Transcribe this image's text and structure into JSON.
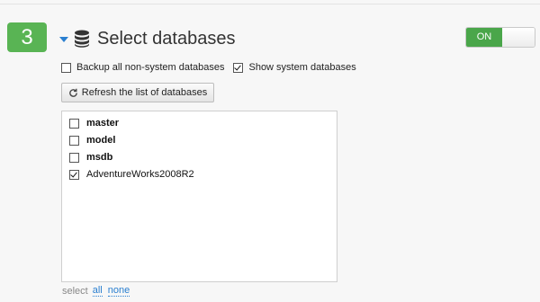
{
  "step": {
    "number": "3"
  },
  "header": {
    "title": "Select databases",
    "icon": "database-icon"
  },
  "toggle": {
    "label": "ON",
    "state": "on"
  },
  "options": {
    "backup_all_nonsystem": {
      "label": "Backup all non-system databases",
      "checked": false
    },
    "show_system": {
      "label": "Show system databases",
      "checked": true
    }
  },
  "refresh_button": {
    "label": "Refresh the list of databases",
    "icon": "refresh-icon"
  },
  "databases": [
    {
      "name": "master",
      "checked": false,
      "system": true
    },
    {
      "name": "model",
      "checked": false,
      "system": true
    },
    {
      "name": "msdb",
      "checked": false,
      "system": true
    },
    {
      "name": "AdventureWorks2008R2",
      "checked": true,
      "system": false
    }
  ],
  "select": {
    "label": "select",
    "all": "all",
    "none": "none"
  },
  "colors": {
    "accent_green": "#59b454",
    "toggle_green": "#4aa64a",
    "link_blue": "#2a7fd0"
  }
}
